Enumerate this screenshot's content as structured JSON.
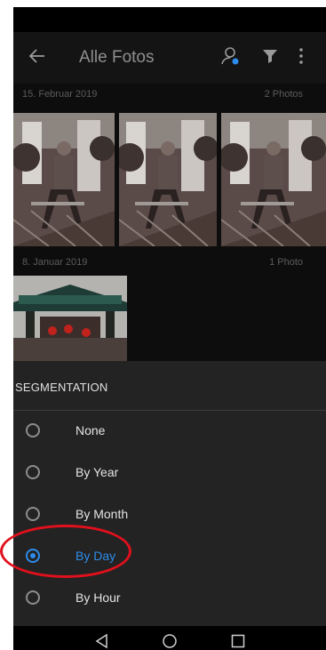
{
  "app_bar": {
    "title": "Alle Fotos",
    "back_icon": "arrow-left-icon",
    "people_icon": "people-search-icon",
    "filter_icon": "filter-icon",
    "more_icon": "more-vertical-icon"
  },
  "groups": [
    {
      "date": "15. Februar 2019",
      "count": "2 Photos"
    },
    {
      "date": "8. Januar 2019",
      "count": "1 Photo"
    }
  ],
  "segmentation": {
    "title": "SEGMENTATION",
    "options": [
      {
        "label": "None",
        "selected": false
      },
      {
        "label": "By Year",
        "selected": false
      },
      {
        "label": "By Month",
        "selected": false
      },
      {
        "label": "By Day",
        "selected": true
      },
      {
        "label": "By Hour",
        "selected": false
      }
    ]
  },
  "nav": {
    "back_icon": "nav-back-icon",
    "home_icon": "nav-home-icon",
    "recents_icon": "nav-recents-icon"
  },
  "colors": {
    "accent": "#2d8ceb",
    "annotation": "#e0101c",
    "sheet_bg": "#232323"
  }
}
